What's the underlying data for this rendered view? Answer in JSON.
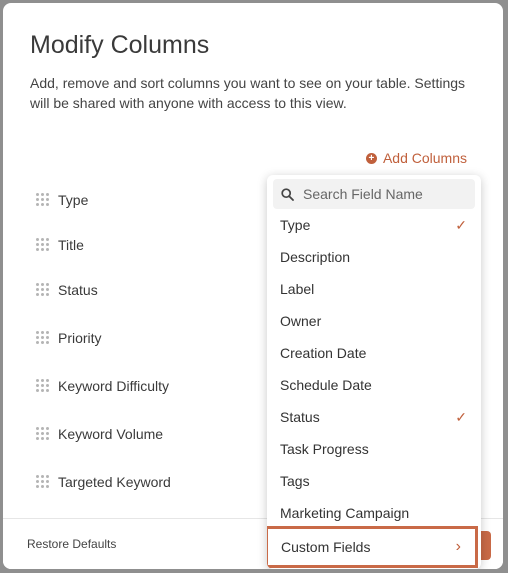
{
  "modal": {
    "title": "Modify Columns",
    "description": "Add, remove and sort columns you want to see on your table. Settings will be shared with anyone with access to this view.",
    "add_columns_label": "Add Columns",
    "columns": [
      {
        "label": "Type"
      },
      {
        "label": "Title"
      },
      {
        "label": "Status"
      },
      {
        "label": "Priority"
      },
      {
        "label": "Keyword Difficulty"
      },
      {
        "label": "Keyword Volume"
      },
      {
        "label": "Targeted Keyword"
      }
    ],
    "restore_defaults_label": "Restore Defaults"
  },
  "dropdown": {
    "search_placeholder": "Search Field Name",
    "options": [
      {
        "label": "Type",
        "checked": true
      },
      {
        "label": "Description",
        "checked": false
      },
      {
        "label": "Label",
        "checked": false
      },
      {
        "label": "Owner",
        "checked": false
      },
      {
        "label": "Creation Date",
        "checked": false
      },
      {
        "label": "Schedule Date",
        "checked": false
      },
      {
        "label": "Status",
        "checked": true
      },
      {
        "label": "Task Progress",
        "checked": false
      },
      {
        "label": "Tags",
        "checked": false
      },
      {
        "label": "Marketing Campaign",
        "checked": false
      }
    ],
    "custom_fields_label": "Custom Fields"
  },
  "colors": {
    "accent": "#c0603c",
    "highlight_border": "#c96a47"
  },
  "icons": {
    "add": "plus-circle-icon",
    "search": "search-icon",
    "check": "checkmark-icon",
    "drag": "drag-handle-icon",
    "chevron": "chevron-right-icon"
  }
}
